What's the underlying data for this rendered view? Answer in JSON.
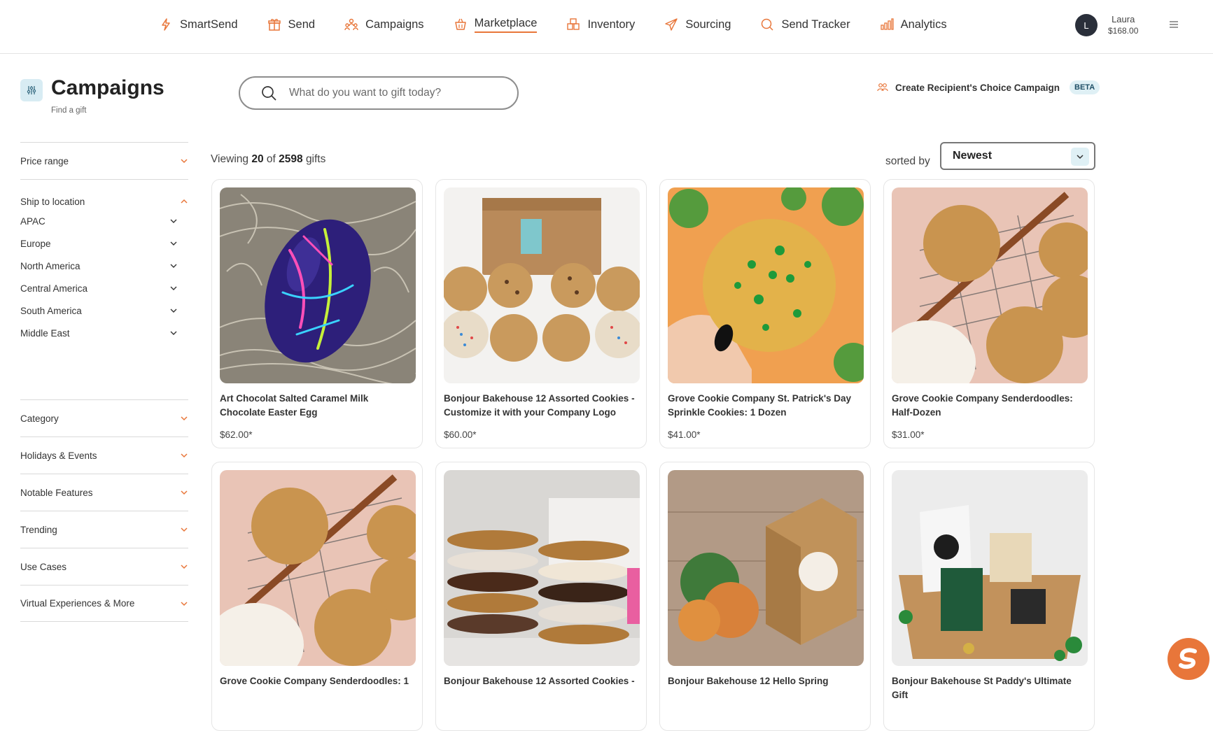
{
  "nav": {
    "items": [
      {
        "label": "SmartSend",
        "icon": "lightning-icon"
      },
      {
        "label": "Send",
        "icon": "gift-icon"
      },
      {
        "label": "Campaigns",
        "icon": "people-icon"
      },
      {
        "label": "Marketplace",
        "icon": "basket-icon",
        "active": true
      },
      {
        "label": "Inventory",
        "icon": "boxes-icon"
      },
      {
        "label": "Sourcing",
        "icon": "paper-plane-icon"
      },
      {
        "label": "Send Tracker",
        "icon": "search-icon"
      },
      {
        "label": "Analytics",
        "icon": "bar-chart-icon"
      }
    ],
    "accent": "#e8763a"
  },
  "user": {
    "initial": "L",
    "name": "Laura",
    "balance": "$168.00"
  },
  "page": {
    "title": "Campaigns",
    "subtitle": "Find a gift"
  },
  "search": {
    "placeholder": "What do you want to gift today?"
  },
  "recipient_choice": {
    "label": "Create Recipient's Choice Campaign",
    "badge": "BETA"
  },
  "results": {
    "prefix": "Viewing",
    "shown": "20",
    "of": "of",
    "total": "2598",
    "suffix": "gifts"
  },
  "sort": {
    "label": "sorted by",
    "value": "Newest"
  },
  "filters": {
    "price_range": "Price range",
    "ship_to": "Ship to location",
    "regions": [
      "APAC",
      "Europe",
      "North America",
      "Central America",
      "South America",
      "Middle East"
    ],
    "rest": [
      "Category",
      "Holidays & Events",
      "Notable Features",
      "Trending",
      "Use Cases",
      "Virtual Experiences & More"
    ]
  },
  "products": [
    {
      "name": "Art Chocolat Salted Caramel Milk Chocolate Easter Egg",
      "price": "$62.00*",
      "image": "chocolate-egg"
    },
    {
      "name": "Bonjour Bakehouse 12 Assorted Cookies - Customize it with your Company Logo",
      "price": "$60.00*",
      "image": "cookie-box"
    },
    {
      "name": "Grove Cookie Company St. Patrick's Day Sprinkle Cookies: 1 Dozen",
      "price": "$41.00*",
      "image": "green-sprinkle-cookie"
    },
    {
      "name": "Grove Cookie Company Senderdoodles: Half-Dozen",
      "price": "$31.00*",
      "image": "snickerdoodles"
    },
    {
      "name": "Grove Cookie Company Senderdoodles: 1",
      "price": "",
      "image": "snickerdoodles"
    },
    {
      "name": "Bonjour Bakehouse 12 Assorted Cookies -",
      "price": "",
      "image": "cookie-stack"
    },
    {
      "name": "Bonjour Bakehouse 12 Hello Spring",
      "price": "",
      "image": "spring-cookies"
    },
    {
      "name": "Bonjour Bakehouse St Paddy's Ultimate Gift",
      "price": "",
      "image": "gift-box"
    }
  ]
}
